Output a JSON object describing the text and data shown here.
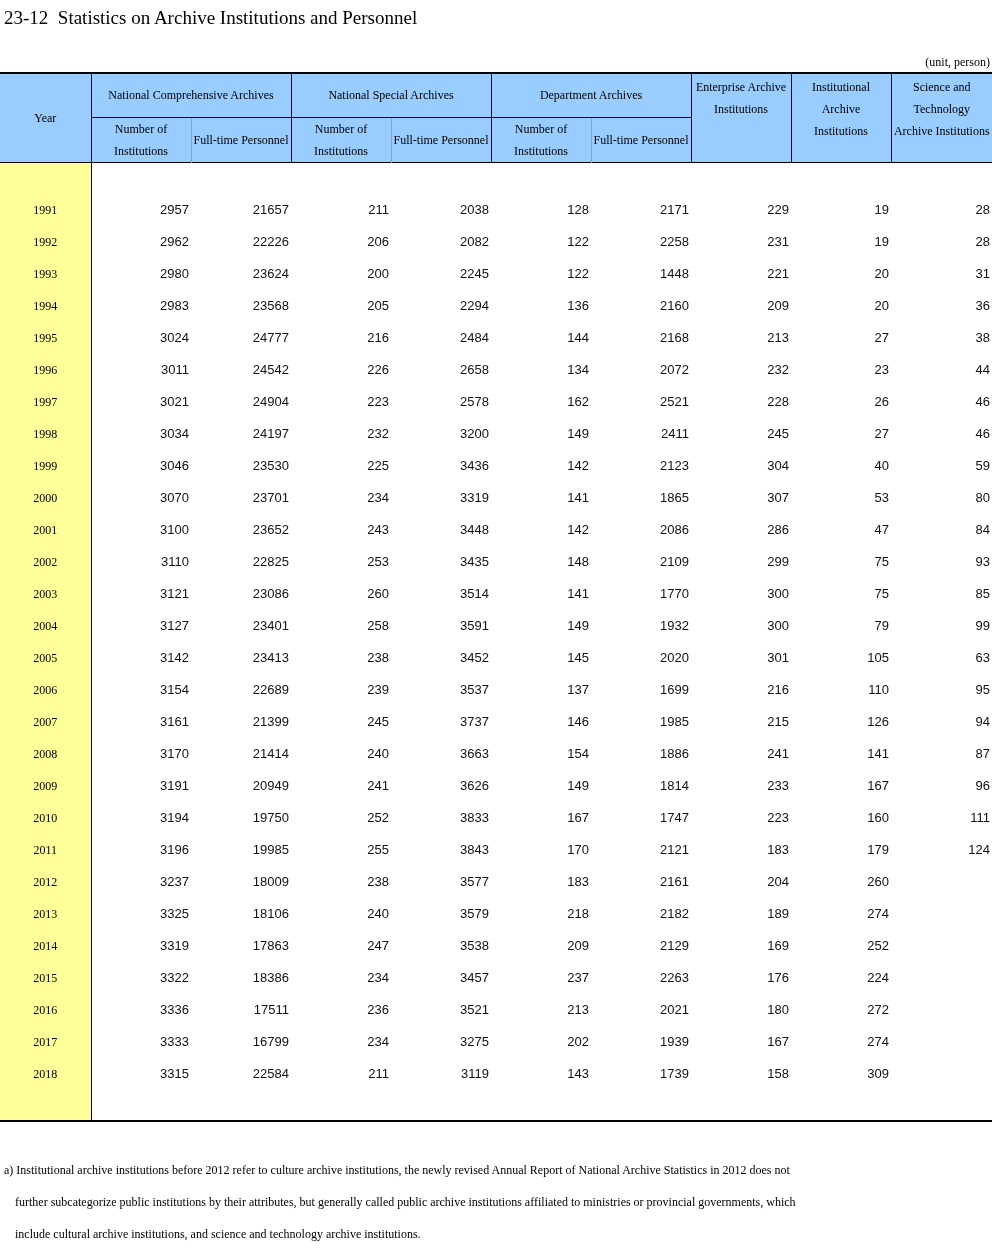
{
  "title": "23-12  Statistics on Archive Institutions and Personnel",
  "unit": "(unit, person)",
  "table": {
    "year_header": "Year",
    "column_groups": [
      {
        "label": "National Comprehensive Archives",
        "columns": [
          "Number of Institutions",
          "Full-time Personnel"
        ]
      },
      {
        "label": "National Special Archives",
        "columns": [
          "Number of Institutions",
          "Full-time Personnel"
        ]
      },
      {
        "label": "Department Archives",
        "columns": [
          "Number of Institutions",
          "Full-time Personnel"
        ]
      },
      {
        "label": "Enterprise Archive Institutions"
      },
      {
        "label": "Institutional Archive Institutions"
      },
      {
        "label": "Science and Technology Archive Institutions"
      }
    ],
    "rows": [
      {
        "year": "1991",
        "values": [
          "2957",
          "21657",
          "211",
          "2038",
          "128",
          "2171",
          "229",
          "19",
          "28"
        ]
      },
      {
        "year": "1992",
        "values": [
          "2962",
          "22226",
          "206",
          "2082",
          "122",
          "2258",
          "231",
          "19",
          "28"
        ]
      },
      {
        "year": "1993",
        "values": [
          "2980",
          "23624",
          "200",
          "2245",
          "122",
          "1448",
          "221",
          "20",
          "31"
        ]
      },
      {
        "year": "1994",
        "values": [
          "2983",
          "23568",
          "205",
          "2294",
          "136",
          "2160",
          "209",
          "20",
          "36"
        ]
      },
      {
        "year": "1995",
        "values": [
          "3024",
          "24777",
          "216",
          "2484",
          "144",
          "2168",
          "213",
          "27",
          "38"
        ]
      },
      {
        "year": "1996",
        "values": [
          "3011",
          "24542",
          "226",
          "2658",
          "134",
          "2072",
          "232",
          "23",
          "44"
        ]
      },
      {
        "year": "1997",
        "values": [
          "3021",
          "24904",
          "223",
          "2578",
          "162",
          "2521",
          "228",
          "26",
          "46"
        ]
      },
      {
        "year": "1998",
        "values": [
          "3034",
          "24197",
          "232",
          "3200",
          "149",
          "2411",
          "245",
          "27",
          "46"
        ]
      },
      {
        "year": "1999",
        "values": [
          "3046",
          "23530",
          "225",
          "3436",
          "142",
          "2123",
          "304",
          "40",
          "59"
        ]
      },
      {
        "year": "2000",
        "values": [
          "3070",
          "23701",
          "234",
          "3319",
          "141",
          "1865",
          "307",
          "53",
          "80"
        ]
      },
      {
        "year": "2001",
        "values": [
          "3100",
          "23652",
          "243",
          "3448",
          "142",
          "2086",
          "286",
          "47",
          "84"
        ]
      },
      {
        "year": "2002",
        "values": [
          "3110",
          "22825",
          "253",
          "3435",
          "148",
          "2109",
          "299",
          "75",
          "93"
        ]
      },
      {
        "year": "2003",
        "values": [
          "3121",
          "23086",
          "260",
          "3514",
          "141",
          "1770",
          "300",
          "75",
          "85"
        ]
      },
      {
        "year": "2004",
        "values": [
          "3127",
          "23401",
          "258",
          "3591",
          "149",
          "1932",
          "300",
          "79",
          "99"
        ]
      },
      {
        "year": "2005",
        "values": [
          "3142",
          "23413",
          "238",
          "3452",
          "145",
          "2020",
          "301",
          "105",
          "63"
        ]
      },
      {
        "year": "2006",
        "values": [
          "3154",
          "22689",
          "239",
          "3537",
          "137",
          "1699",
          "216",
          "110",
          "95"
        ]
      },
      {
        "year": "2007",
        "values": [
          "3161",
          "21399",
          "245",
          "3737",
          "146",
          "1985",
          "215",
          "126",
          "94"
        ]
      },
      {
        "year": "2008",
        "values": [
          "3170",
          "21414",
          "240",
          "3663",
          "154",
          "1886",
          "241",
          "141",
          "87"
        ]
      },
      {
        "year": "2009",
        "values": [
          "3191",
          "20949",
          "241",
          "3626",
          "149",
          "1814",
          "233",
          "167",
          "96"
        ]
      },
      {
        "year": "2010",
        "values": [
          "3194",
          "19750",
          "252",
          "3833",
          "167",
          "1747",
          "223",
          "160",
          "111"
        ]
      },
      {
        "year": "2011",
        "values": [
          "3196",
          "19985",
          "255",
          "3843",
          "170",
          "2121",
          "183",
          "179",
          "124"
        ]
      },
      {
        "year": "2012",
        "values": [
          "3237",
          "18009",
          "238",
          "3577",
          "183",
          "2161",
          "204",
          "260"
        ]
      },
      {
        "year": "2013",
        "values": [
          "3325",
          "18106",
          "240",
          "3579",
          "218",
          "2182",
          "189",
          "274"
        ]
      },
      {
        "year": "2014",
        "values": [
          "3319",
          "17863",
          "247",
          "3538",
          "209",
          "2129",
          "169",
          "252"
        ]
      },
      {
        "year": "2015",
        "values": [
          "3322",
          "18386",
          "234",
          "3457",
          "237",
          "2263",
          "176",
          "224"
        ]
      },
      {
        "year": "2016",
        "values": [
          "3336",
          "17511",
          "236",
          "3521",
          "213",
          "2021",
          "180",
          "272"
        ]
      },
      {
        "year": "2017",
        "values": [
          "3333",
          "16799",
          "234",
          "3275",
          "202",
          "1939",
          "167",
          "274"
        ]
      },
      {
        "year": "2018",
        "values": [
          "3315",
          "22584",
          "211",
          "3119",
          "143",
          "1739",
          "158",
          "309"
        ]
      }
    ]
  },
  "footnote": "a) Institutional archive institutions before 2012 refer to culture archive institutions, the newly revised Annual Report of National Archive Statistics in 2012 does not further subcategorize public institutions by their attributes, but generally called public archive institutions affiliated to ministries or provincial governments, which include cultural archive institutions, and science and technology archive institutions."
}
